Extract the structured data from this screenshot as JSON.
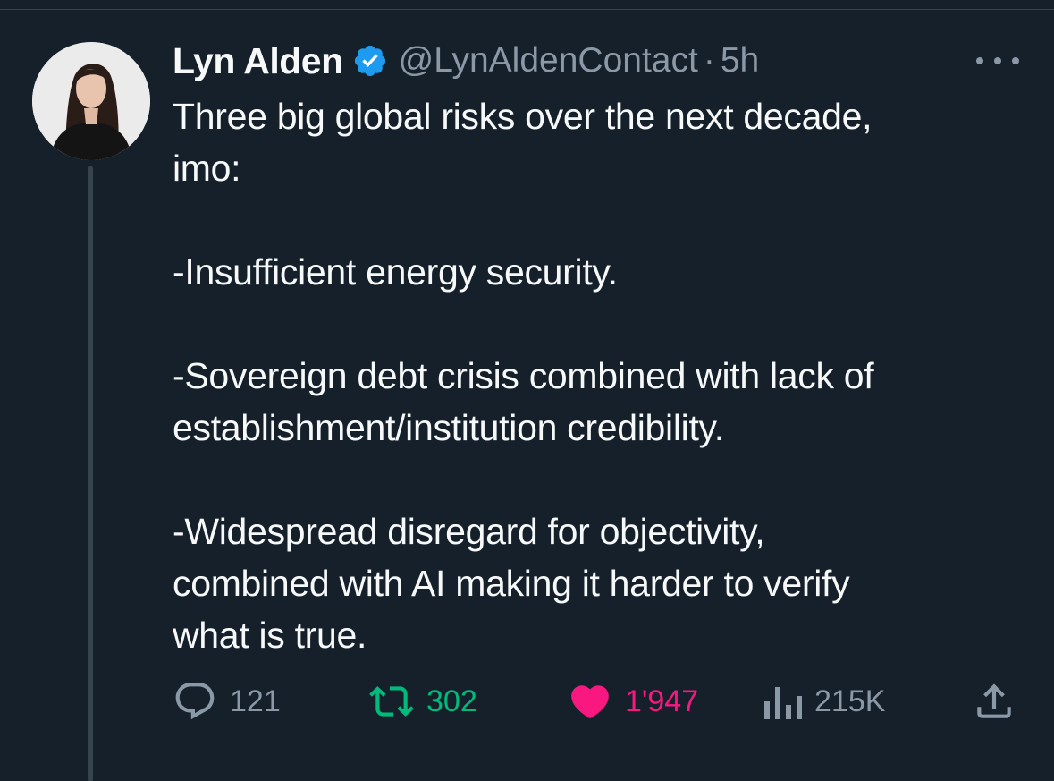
{
  "tweet": {
    "author_name": "Lyn Alden",
    "handle": "@LynAldenContact",
    "separator": "·",
    "time": "5h",
    "verified": true,
    "lines": [
      "Three big global risks over the next decade,",
      "imo:",
      "",
      "-Insufficient energy security.",
      "",
      "-Sovereign debt crisis combined with lack of",
      "establishment/institution credibility.",
      "",
      "-Widespread disregard for objectivity,",
      "combined with AI making it harder to verify",
      "what is true."
    ]
  },
  "actions": {
    "replies": "121",
    "retweets": "302",
    "likes": "1'947",
    "views": "215K"
  },
  "icons": {
    "more": "more-icon",
    "verified": "verified-badge-icon",
    "reply": "reply-icon",
    "retweet": "retweet-icon",
    "like": "heart-icon",
    "views": "views-icon",
    "share": "share-icon"
  },
  "colors": {
    "background": "#15202b",
    "text": "#f7f9f9",
    "muted": "#8b98a5",
    "verified": "#1d9bf0",
    "retweet": "#00ba7c",
    "like": "#f91880"
  }
}
